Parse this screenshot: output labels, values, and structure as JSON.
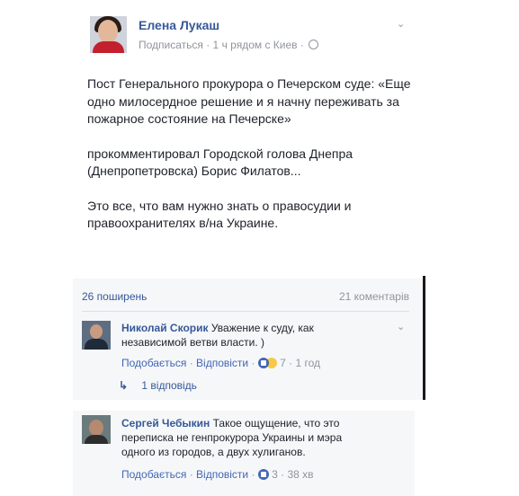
{
  "post": {
    "author": "Елена Лукаш",
    "meta": "Подписаться · 1 ч рядом с Киев ·",
    "paragraphs": [
      "Пост Генерального прокурора о Печерском суде: «Еще одно милосердное решение и я начну переживать за пожарное состояние на Печерске»",
      "прокомментировал Городской голова Днепра (Днепропетровска) Борис Филатов...",
      "Это все, что вам нужно знать о правосудии и правоохранителях в/на Украине."
    ]
  },
  "stats": {
    "shares": "26 поширень",
    "comments": "21 коментарів"
  },
  "comments": [
    {
      "name": "Николай Скорик",
      "text": "Уважение к суду, как независимой ветви власти. )",
      "like": "Подобається",
      "reply": "Відповісти",
      "count": "7",
      "time": "1 год",
      "replies": "1 відповідь"
    },
    {
      "name": "Сергей Чебыкин",
      "text": "Такое ощущение, что это переписка не генпрокурора Украины и мэра одного из городов, а двух хулиганов.",
      "like": "Подобається",
      "reply": "Відповісти",
      "count": "3",
      "time": "38 хв"
    }
  ],
  "icons": [
    "globe-icon",
    "chevron-down-icon",
    "like-reaction-icon",
    "haha-reaction-icon",
    "reply-arrow-icon"
  ]
}
